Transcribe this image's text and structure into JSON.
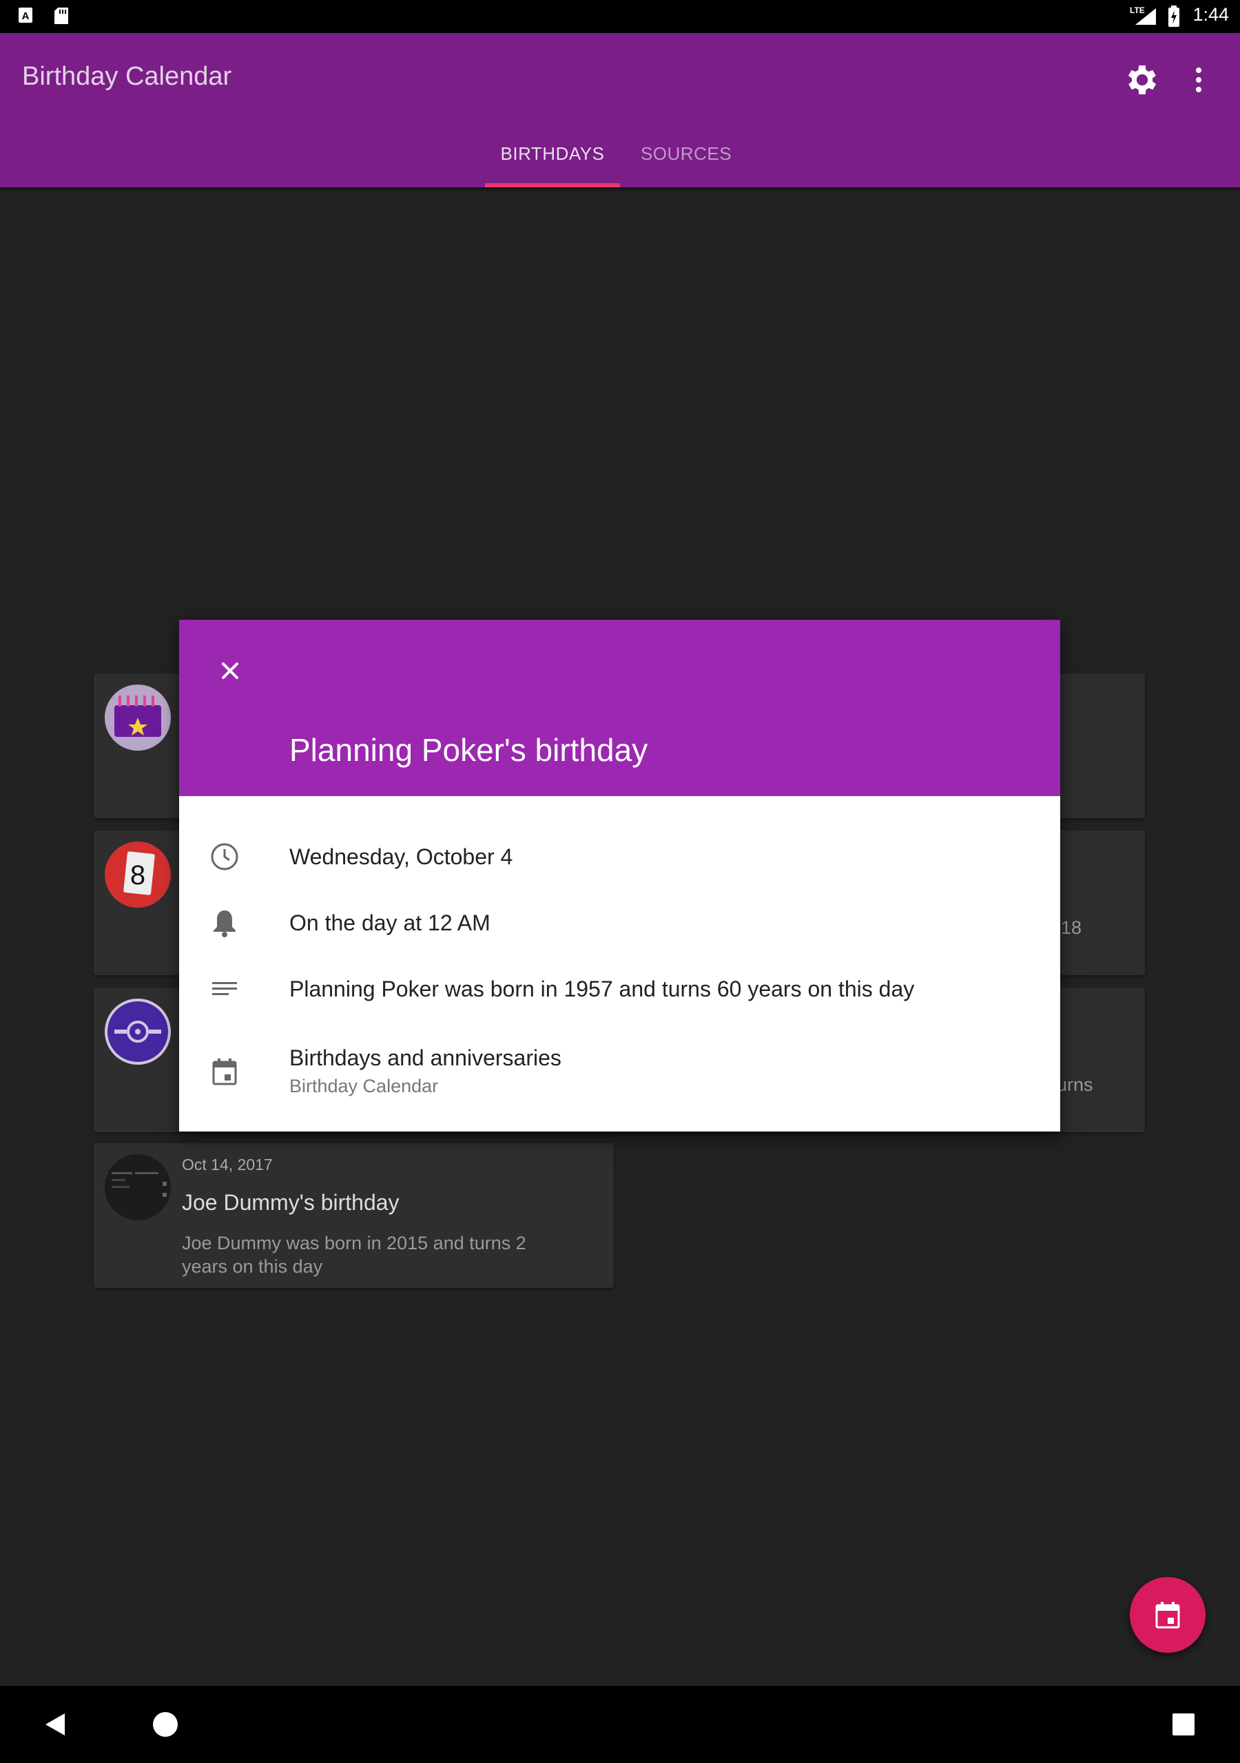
{
  "status_bar": {
    "time": "1:44",
    "network": "LTE",
    "icons": [
      "notification-a-icon",
      "sd-card-icon",
      "signal-icon",
      "battery-charging-icon"
    ]
  },
  "app_bar": {
    "title": "Birthday Calendar",
    "icons": [
      "gear-icon",
      "more-vert-icon"
    ],
    "tabs": [
      {
        "label": "BIRTHDAYS",
        "selected": true
      },
      {
        "label": "SOURCES",
        "selected": false
      }
    ],
    "color": "#7B1E88",
    "indicator_color": "#E8386B"
  },
  "cards": [
    {
      "avatar": "cake-icon",
      "peek_text": ""
    },
    {
      "avatar": "number-eight-card-icon",
      "peek_text": "18"
    },
    {
      "avatar": "disc-icon",
      "peek_text": "urns"
    },
    {
      "avatar": "dark-avatar",
      "date": "Oct 14, 2017",
      "title": "Joe Dummy's birthday",
      "description": "Joe Dummy was born in 2015 and turns 2 years on this day"
    }
  ],
  "dialog": {
    "title": "Planning Poker's birthday",
    "header_color": "#9C27B0",
    "rows": [
      {
        "icon": "clock-icon",
        "text": "Wednesday, October 4"
      },
      {
        "icon": "bell-icon",
        "text": "On the day at 12 AM"
      },
      {
        "icon": "notes-icon",
        "text": "Planning Poker was born in 1957 and turns 60 years on this day"
      },
      {
        "icon": "calendar-icon",
        "text": "Birthdays and anniversaries",
        "subtext": "Birthday Calendar"
      }
    ]
  },
  "fab": {
    "icon": "calendar-icon",
    "color": "#D81B60"
  },
  "nav_bar": {
    "icons": [
      "back-icon",
      "home-icon",
      "recents-icon"
    ]
  }
}
